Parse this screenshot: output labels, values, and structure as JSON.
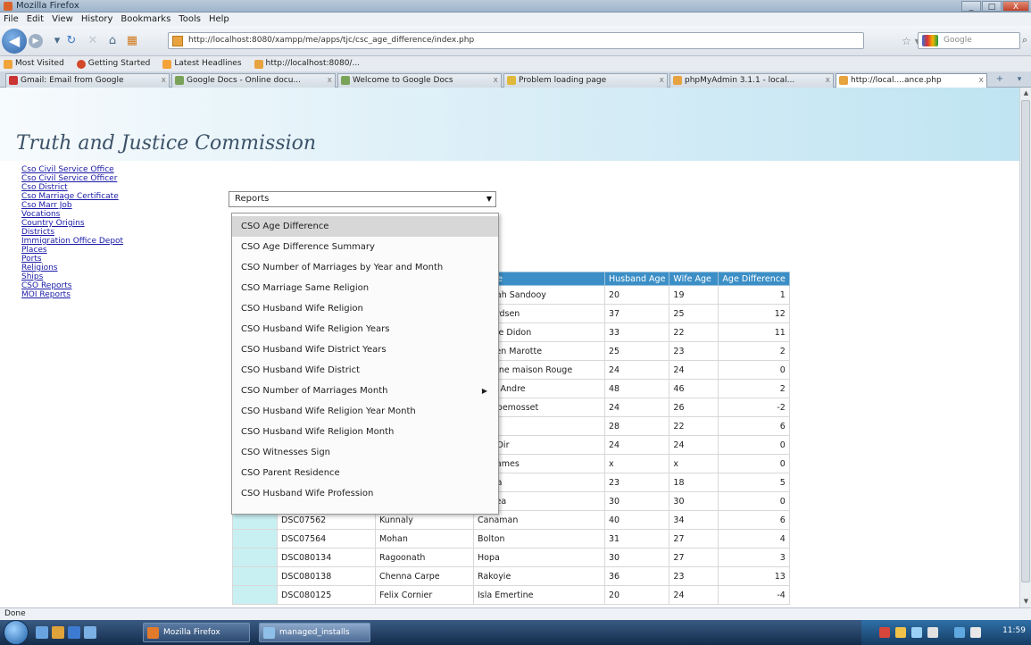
{
  "window": {
    "title": "Mozilla Firefox",
    "buttons": [
      "_",
      "□",
      "X"
    ]
  },
  "menu": [
    "File",
    "Edit",
    "View",
    "History",
    "Bookmarks",
    "Tools",
    "Help"
  ],
  "nav": {
    "url": "http://localhost:8080/xampp/me/apps/tjc/csc_age_difference/index.php",
    "search_placeholder": "Google"
  },
  "bookmarks": [
    "Most Visited",
    "Getting Started",
    "Latest Headlines",
    "http://localhost:8080/..."
  ],
  "tabs": [
    {
      "label": "Gmail: Email from Google",
      "active": false
    },
    {
      "label": "Google Docs - Online docu...",
      "active": false
    },
    {
      "label": "Welcome to Google Docs",
      "active": false
    },
    {
      "label": "Problem loading page",
      "active": false
    },
    {
      "label": "phpMyAdmin 3.1.1 - local...",
      "active": false
    },
    {
      "label": "http://local....ance.php",
      "active": true
    }
  ],
  "site": {
    "title": "Truth and Justice Commission"
  },
  "sidenav": [
    "Cso Civil Service Office",
    "Cso Civil Service Officer",
    "Cso District",
    "Cso Marriage Certificate",
    "Cso Marr Job",
    "Vocations",
    "Country Origins",
    "Districts",
    "Immigration Office Depot",
    "Places",
    "Ports",
    "Religions",
    "Ships",
    "CSO Reports",
    "MOI Reports"
  ],
  "reports": {
    "label": "Reports",
    "items": [
      {
        "label": "CSO Age Difference",
        "selected": true,
        "submenu": false
      },
      {
        "label": "CSO Age Difference Summary",
        "selected": false,
        "submenu": false
      },
      {
        "label": "CSO Number of Marriages by Year and Month",
        "selected": false,
        "submenu": false
      },
      {
        "label": "CSO Marriage Same Religion",
        "selected": false,
        "submenu": false
      },
      {
        "label": "CSO Husband Wife Religion",
        "selected": false,
        "submenu": false
      },
      {
        "label": "CSO Husband Wife Religion Years",
        "selected": false,
        "submenu": false
      },
      {
        "label": "CSO Husband Wife District Years",
        "selected": false,
        "submenu": false
      },
      {
        "label": "CSO Husband Wife District",
        "selected": false,
        "submenu": false
      },
      {
        "label": "CSO Number of Marriages Month",
        "selected": false,
        "submenu": true
      },
      {
        "label": "CSO Husband Wife Religion Year Month",
        "selected": false,
        "submenu": false
      },
      {
        "label": "CSO Husband Wife Religion Month",
        "selected": false,
        "submenu": false
      },
      {
        "label": "CSO Witnesses Sign",
        "selected": false,
        "submenu": false
      },
      {
        "label": "CSO Parent Residence",
        "selected": false,
        "submenu": false
      },
      {
        "label": "CSO Husband Wife Profession",
        "selected": false,
        "submenu": false
      }
    ]
  },
  "table": {
    "headers": [
      "",
      "",
      "",
      "Name",
      "Husband Age",
      "Wife Age",
      "Age Difference"
    ],
    "rows": [
      [
        "",
        "",
        "",
        "...ouah Sandooy",
        "20",
        "19",
        "1"
      ],
      [
        "",
        "",
        "",
        "...eerdsen",
        "37",
        "25",
        "12"
      ],
      [
        "",
        "",
        "",
        "...anie Didon",
        "33",
        "22",
        "11"
      ],
      [
        "",
        "",
        "",
        "...isten Marotte",
        "25",
        "23",
        "2"
      ],
      [
        "",
        "",
        "",
        "...iatine maison Rouge",
        "24",
        "24",
        "0"
      ],
      [
        "",
        "",
        "",
        "...ies Andre",
        "48",
        "46",
        "2"
      ],
      [
        "",
        "",
        "",
        "...ra pemosset",
        "24",
        "26",
        "-2"
      ],
      [
        "",
        "",
        "",
        "...ne",
        "28",
        "22",
        "6"
      ],
      [
        "",
        "",
        "",
        "...re Dir",
        "24",
        "24",
        "0"
      ],
      [
        "",
        "",
        "",
        "...n James",
        "x",
        "x",
        "0"
      ],
      [
        "",
        "",
        "",
        "...ssia",
        "23",
        "18",
        "5"
      ],
      [
        "",
        "",
        "",
        "...avea",
        "30",
        "30",
        "0"
      ],
      [
        "",
        "DSC07562",
        "Kunnaly",
        "Canaman",
        "40",
        "34",
        "6"
      ],
      [
        "",
        "DSC07564",
        "Mohan",
        "Bolton",
        "31",
        "27",
        "4"
      ],
      [
        "",
        "DSC080134",
        "Ragoonath",
        "Hopa",
        "30",
        "27",
        "3"
      ],
      [
        "",
        "DSC080138",
        "Chenna Carpe",
        "Rakoyie",
        "36",
        "23",
        "13"
      ],
      [
        "",
        "DSC080125",
        "Felix Cornier",
        "Isla Emertine",
        "20",
        "24",
        "-4"
      ]
    ]
  },
  "status": {
    "text": "Done"
  },
  "taskbar": {
    "items": [
      "Mozilla Firefox",
      "managed_installs"
    ],
    "clock": "11:59"
  }
}
